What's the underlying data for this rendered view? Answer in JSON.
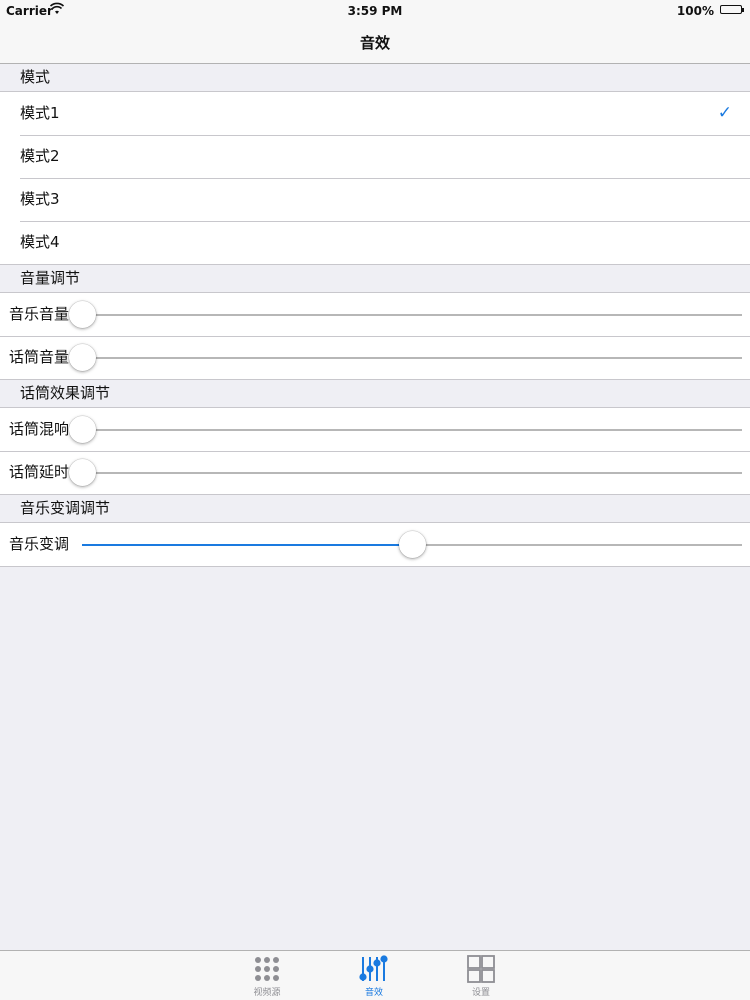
{
  "status_bar": {
    "carrier": "Carrier",
    "time": "3:59 PM",
    "battery": "100%"
  },
  "nav": {
    "title": "音效"
  },
  "sections": {
    "mode": {
      "header": "模式",
      "items": [
        {
          "label": "模式1",
          "selected": true
        },
        {
          "label": "模式2",
          "selected": false
        },
        {
          "label": "模式3",
          "selected": false
        },
        {
          "label": "模式4",
          "selected": false
        }
      ]
    },
    "volume": {
      "header": "音量调节",
      "sliders": [
        {
          "label": "音乐音量",
          "value": 0
        },
        {
          "label": "话筒音量",
          "value": 0
        }
      ]
    },
    "mic_effect": {
      "header": "话筒效果调节",
      "sliders": [
        {
          "label": "话筒混响",
          "value": 0
        },
        {
          "label": "话筒延时",
          "value": 0
        }
      ]
    },
    "pitch": {
      "header": "音乐变调调节",
      "sliders": [
        {
          "label": "音乐变调",
          "value": 0.5
        }
      ]
    }
  },
  "tabs": [
    {
      "label": "视频源",
      "icon": "grid-dots-icon",
      "active": false
    },
    {
      "label": "音效",
      "icon": "equalizer-icon",
      "active": true
    },
    {
      "label": "设置",
      "icon": "four-squares-icon",
      "active": false
    }
  ],
  "colors": {
    "accent": "#1a7ae0",
    "background": "#efeff4",
    "separator": "#c8c7cc"
  }
}
